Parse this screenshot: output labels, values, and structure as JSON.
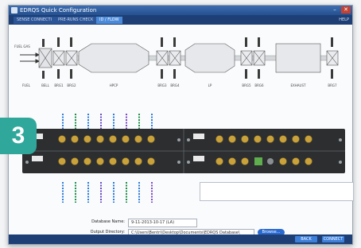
{
  "window": {
    "title": "EDRQS Quick Configuration",
    "close_glyph": "✕",
    "minimize_glyph": "–"
  },
  "tabs": [
    {
      "label": "SENSE CONNECTI",
      "active": false
    },
    {
      "label": "PRE-RUNS CHECK",
      "active": false
    },
    {
      "label": "ID / FLOW",
      "active": true
    }
  ],
  "tab_right_label": "HELP",
  "diagram": {
    "labels": {
      "fuel": "FUEL",
      "bell": "BELL",
      "brg1": "BRG1",
      "brg2": "BRG2",
      "hpcp": "HPCP",
      "brg3": "BRG3",
      "brg4": "BRG4",
      "lp": "LP",
      "brg5": "BRG5",
      "brg6": "BRG6",
      "exhaust": "EXHAUST",
      "brg7": "BRG7",
      "fuel_gas": "FUEL GAS"
    }
  },
  "section_number": "3",
  "form": {
    "database_name_label": "Database Name:",
    "database_name_value": "9-11-2013-10-17 (LA)",
    "output_directory_label": "Output Directory:",
    "output_directory_value": "C:\\Users\\Bentri\\Desktop\\Documents\\EDRQS Database\\",
    "browse_label": "Browse..."
  },
  "bottom": {
    "back_label": "BACK",
    "connect_label": "CONNECT"
  },
  "colors": {
    "accent": "#2fa79a",
    "titlebar": "#24508f",
    "tabbar": "#1d3f75",
    "button": "#3d7fd9",
    "rack": "#2c2e30",
    "connector": "#c9a23c"
  },
  "icons": {
    "app": "app-icon",
    "close": "close-icon",
    "minimize": "minimize-icon"
  }
}
